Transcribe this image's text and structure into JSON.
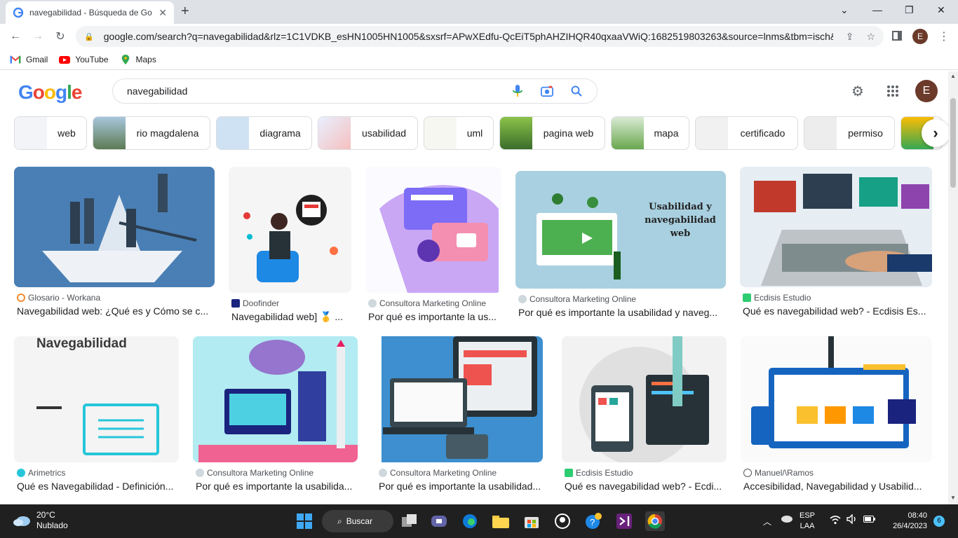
{
  "browser": {
    "tab_title": "navegabilidad - Búsqueda de Go",
    "url": "google.com/search?q=navegabilidad&rlz=1C1VDKB_esHN1005HN1005&sxsrf=APwXEdfu-QcEiT5phAHZIHQR40qxaaVWiQ:1682519803263&source=lnms&tbm=isch&s...",
    "profile_initial": "E",
    "bookmarks": [
      {
        "label": "Gmail",
        "icon": "gmail-icon"
      },
      {
        "label": "YouTube",
        "icon": "youtube-icon"
      },
      {
        "label": "Maps",
        "icon": "maps-icon"
      }
    ]
  },
  "google": {
    "logo": "Google",
    "query": "navegabilidad",
    "account_initial": "E",
    "chips": [
      {
        "label": "web"
      },
      {
        "label": "rio magdalena"
      },
      {
        "label": "diagrama"
      },
      {
        "label": "usabilidad"
      },
      {
        "label": "uml"
      },
      {
        "label": "pagina web"
      },
      {
        "label": "mapa"
      },
      {
        "label": "certificado"
      },
      {
        "label": "permiso"
      }
    ],
    "results": [
      {
        "source": "Glosario - Workana",
        "title": "Navegabilidad web: ¿Qué es y Cómo se c..."
      },
      {
        "source": "Doofinder",
        "title": "Navegabilidad web] 🥇 ..."
      },
      {
        "source": "Consultora Marketing Online",
        "title": "Por qué es importante la us..."
      },
      {
        "source": "Consultora Marketing Online",
        "title": "Por qué es importante la usabilidad y naveg...",
        "image_text": "Usabilidad y navegabilidad web"
      },
      {
        "source": "Ecdisis Estudio",
        "title": "Qué es navegabilidad web? - Ecdisis Es..."
      },
      {
        "source": "Arimetrics",
        "title": "Qué es Navegabilidad - Definición...",
        "image_text": "Navegabilidad"
      },
      {
        "source": "Consultora Marketing Online",
        "title": "Por qué es importante la usabilida..."
      },
      {
        "source": "Consultora Marketing Online",
        "title": "Por qué es importante la usabilidad..."
      },
      {
        "source": "Ecdisis Estudio",
        "title": "Qué es navegabilidad web? - Ecdi..."
      },
      {
        "source": "Manuel/\\Ramos",
        "title": "Accesibilidad, Navegabilidad y Usabilid..."
      }
    ]
  },
  "taskbar": {
    "temp": "20°C",
    "weather": "Nublado",
    "search_label": "Buscar",
    "lang1": "ESP",
    "lang2": "LAA",
    "time": "08:40",
    "date": "26/4/2023",
    "notifications": "6"
  }
}
